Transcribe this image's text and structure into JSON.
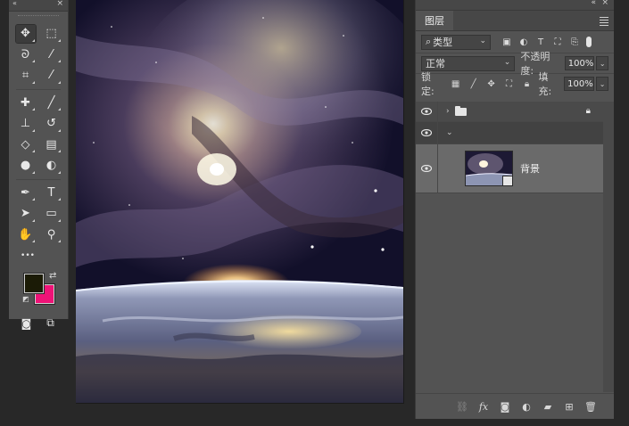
{
  "tools": {
    "rows": [
      [
        {
          "name": "move-tool",
          "glyph": "✥",
          "active": true
        },
        {
          "name": "marquee-tool",
          "glyph": "⬚"
        }
      ],
      [
        {
          "name": "lasso-tool",
          "glyph": "ᘐ"
        },
        {
          "name": "magic-wand-tool",
          "glyph": "⁄"
        }
      ],
      [
        {
          "name": "crop-tool",
          "glyph": "⌗"
        },
        {
          "name": "eyedropper-tool",
          "glyph": "⁄"
        }
      ],
      [
        {
          "name": "healing-brush-tool",
          "glyph": "✚"
        },
        {
          "name": "brush-tool",
          "glyph": "╱"
        }
      ],
      [
        {
          "name": "clone-stamp-tool",
          "glyph": "⊥"
        },
        {
          "name": "history-brush-tool",
          "glyph": "↺"
        }
      ],
      [
        {
          "name": "eraser-tool",
          "glyph": "◇"
        },
        {
          "name": "gradient-tool",
          "glyph": "▤"
        }
      ],
      [
        {
          "name": "blur-tool",
          "glyph": "●"
        },
        {
          "name": "dodge-tool",
          "glyph": "◐"
        }
      ],
      [
        {
          "name": "pen-tool",
          "glyph": "✒"
        },
        {
          "name": "type-tool",
          "glyph": "T"
        }
      ],
      [
        {
          "name": "path-selection-tool",
          "glyph": "➤"
        },
        {
          "name": "rectangle-tool",
          "glyph": "▭"
        }
      ],
      [
        {
          "name": "hand-tool",
          "glyph": "✋"
        },
        {
          "name": "zoom-tool",
          "glyph": "⚲"
        }
      ]
    ],
    "more_glyph": "•••",
    "foreground_color": "#1b1b06",
    "background_color": "#ef1377"
  },
  "layers_panel": {
    "tab_label": "图层",
    "filter": {
      "label": "类型",
      "search_glyph": "⌕"
    },
    "blend_mode": "正常",
    "opacity_label": "不透明度:",
    "opacity_value": "100%",
    "lock_label": "锁定:",
    "fill_label": "填充:",
    "fill_value": "100%",
    "layers": [
      {
        "type": "group",
        "collapsed": true,
        "locked": true,
        "visible": true,
        "name": ""
      },
      {
        "type": "group",
        "collapsed": false,
        "visible": true,
        "name": ""
      },
      {
        "type": "smart-object",
        "visible": true,
        "name": "背景"
      }
    ],
    "footer_icons": [
      "link-icon",
      "fx-icon",
      "mask-icon",
      "adjustment-icon",
      "new-group-icon",
      "new-layer-icon",
      "trash-icon"
    ]
  },
  "panel_collapse_glyph": "«",
  "panel_close_glyph": "×"
}
